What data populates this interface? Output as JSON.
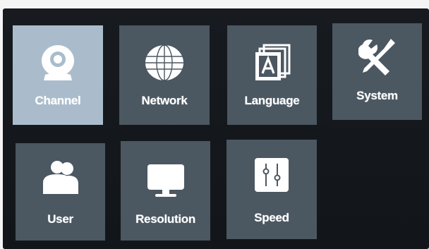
{
  "menu": {
    "items": [
      {
        "label": "Channel",
        "icon": "camera-icon",
        "selected": true
      },
      {
        "label": "Network",
        "icon": "globe-icon",
        "selected": false
      },
      {
        "label": "Language",
        "icon": "language-icon",
        "selected": false
      },
      {
        "label": "System",
        "icon": "tools-icon",
        "selected": false
      },
      {
        "label": "User",
        "icon": "user-icon",
        "selected": false
      },
      {
        "label": "Resolution",
        "icon": "monitor-icon",
        "selected": false
      },
      {
        "label": "Speed",
        "icon": "sliders-icon",
        "selected": false
      }
    ]
  },
  "colors": {
    "tile": "#4b5761",
    "tile_selected": "#aabccc",
    "background": "#14181c"
  }
}
